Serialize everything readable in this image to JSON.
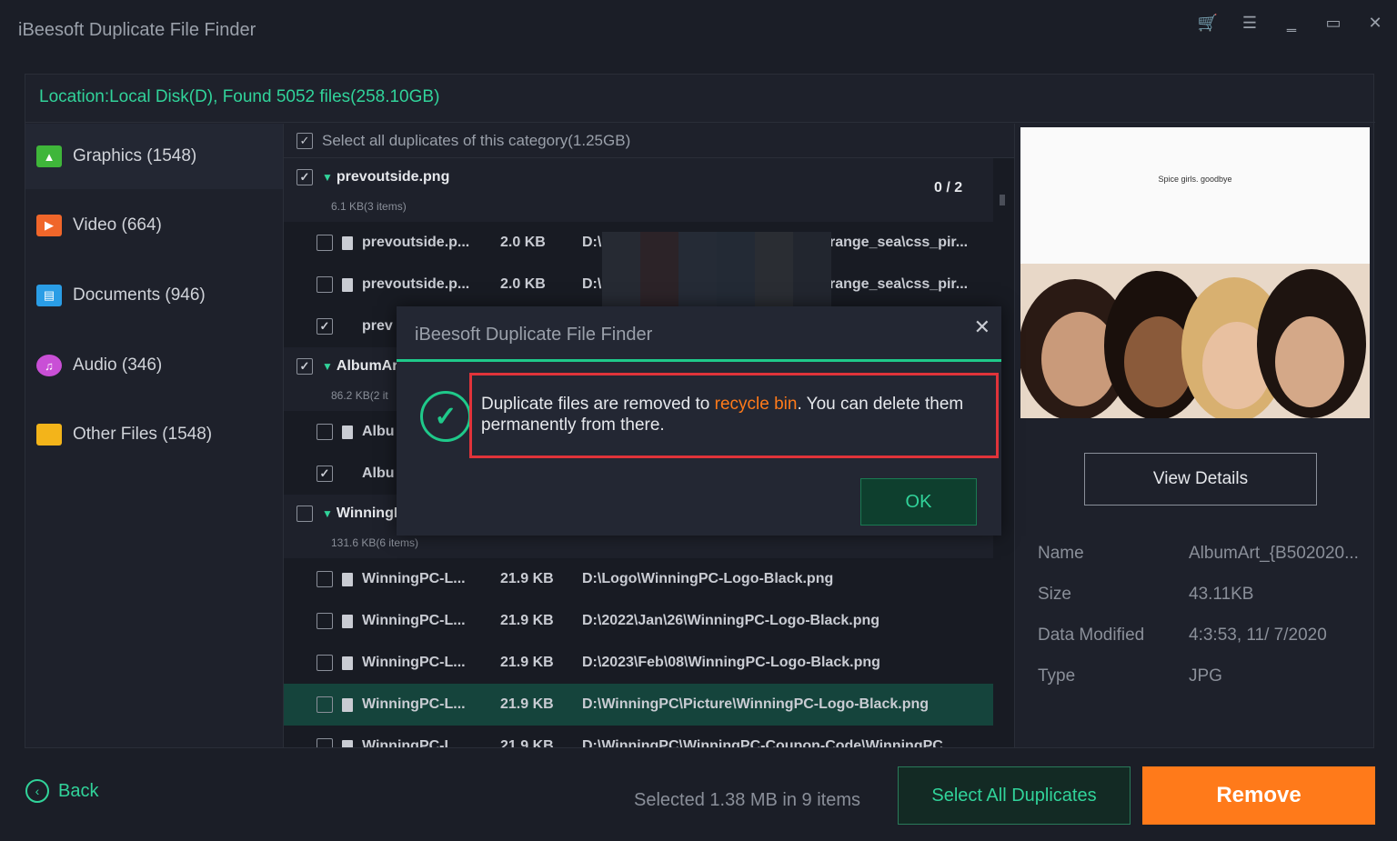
{
  "app": {
    "title": "iBeesoft Duplicate File Finder"
  },
  "window_controls": [
    "cart-icon",
    "menu-icon",
    "minimize-icon",
    "maximize-icon",
    "close-icon"
  ],
  "location": "Location:Local Disk(D), Found 5052 files(258.10GB)",
  "sidebar": {
    "items": [
      {
        "label": "Graphics (1548)",
        "icon": "image-icon",
        "color": "#3fb63a"
      },
      {
        "label": "Video (664)",
        "icon": "video-icon",
        "color": "#f0662a"
      },
      {
        "label": "Documents (946)",
        "icon": "document-icon",
        "color": "#2a9de6"
      },
      {
        "label": "Audio (346)",
        "icon": "audio-icon",
        "color": "#c94fd6"
      },
      {
        "label": "Other Files (1548)",
        "icon": "folder-icon",
        "color": "#f3b41a"
      }
    ]
  },
  "list": {
    "select_all": "Select all duplicates of this category(1.25GB)",
    "groups": [
      {
        "name": "prevoutside.png",
        "sub": "6.1 KB(3 items)",
        "count": "0 / 2",
        "rows": [
          {
            "name": "prevoutside.p...",
            "size": "2.0 KB",
            "path_start": "D:\\",
            "path_end": "range_sea\\css_pir...",
            "checked": false
          },
          {
            "name": "prevoutside.p...",
            "size": "2.0 KB",
            "path_start": "D:\\",
            "path_end": "range_sea\\css_pir...",
            "checked": false
          },
          {
            "name": "prev",
            "checked": true
          }
        ]
      },
      {
        "name": "AlbumArt",
        "sub": "86.2 KB(2 it",
        "rows": [
          {
            "name": "Albu",
            "checked": false
          },
          {
            "name": "Albu",
            "checked": true
          }
        ]
      },
      {
        "name": "WinningP",
        "sub": "131.6 KB(6 items)",
        "rows": [
          {
            "name": "WinningPC-L...",
            "size": "21.9 KB",
            "path": "D:\\Logo\\WinningPC-Logo-Black.png"
          },
          {
            "name": "WinningPC-L...",
            "size": "21.9 KB",
            "path": "D:\\2022\\Jan\\26\\WinningPC-Logo-Black.png"
          },
          {
            "name": "WinningPC-L...",
            "size": "21.9 KB",
            "path": "D:\\2023\\Feb\\08\\WinningPC-Logo-Black.png"
          },
          {
            "name": "WinningPC-L...",
            "size": "21.9 KB",
            "path": "D:\\WinningPC\\Picture\\WinningPC-Logo-Black.png"
          },
          {
            "name": "WinningPC-L...",
            "size": "21.9 KB",
            "path": "D:\\WinningPC\\WinningPC-Coupon-Code\\WinningPC"
          }
        ]
      }
    ]
  },
  "preview": {
    "caption": "Spice girls. goodbye",
    "view_details": "View Details",
    "info": [
      {
        "key": "Name",
        "value": "AlbumArt_{B502020..."
      },
      {
        "key": "Size",
        "value": "43.11KB"
      },
      {
        "key": "Data Modified",
        "value": "4:3:53, 11/ 7/2020"
      },
      {
        "key": "Type",
        "value": "JPG"
      }
    ]
  },
  "footer": {
    "back": "Back",
    "selected": "Selected 1.38 MB in 9 items",
    "select_all_duplicates": "Select All Duplicates",
    "remove": "Remove"
  },
  "dialog": {
    "title": "iBeesoft Duplicate File Finder",
    "msg_before": "Duplicate files are removed to ",
    "msg_highlight": "recycle bin",
    "msg_after": ". You can delete them permanently from there.",
    "ok": "OK"
  }
}
